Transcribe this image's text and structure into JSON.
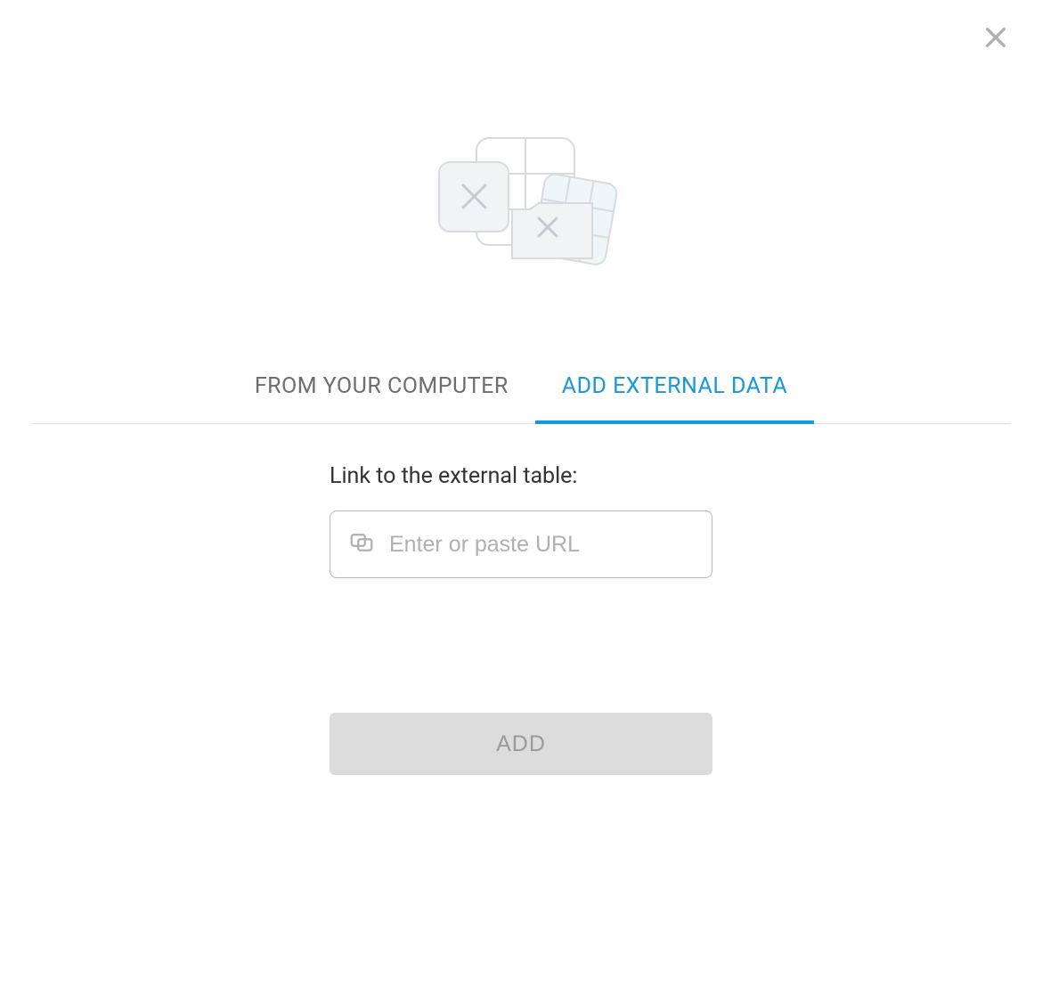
{
  "tabs": {
    "from_computer": "FROM YOUR COMPUTER",
    "add_external": "ADD EXTERNAL DATA"
  },
  "form": {
    "label": "Link to the external table:",
    "placeholder": "Enter or paste URL",
    "value": ""
  },
  "actions": {
    "add_label": "ADD"
  }
}
